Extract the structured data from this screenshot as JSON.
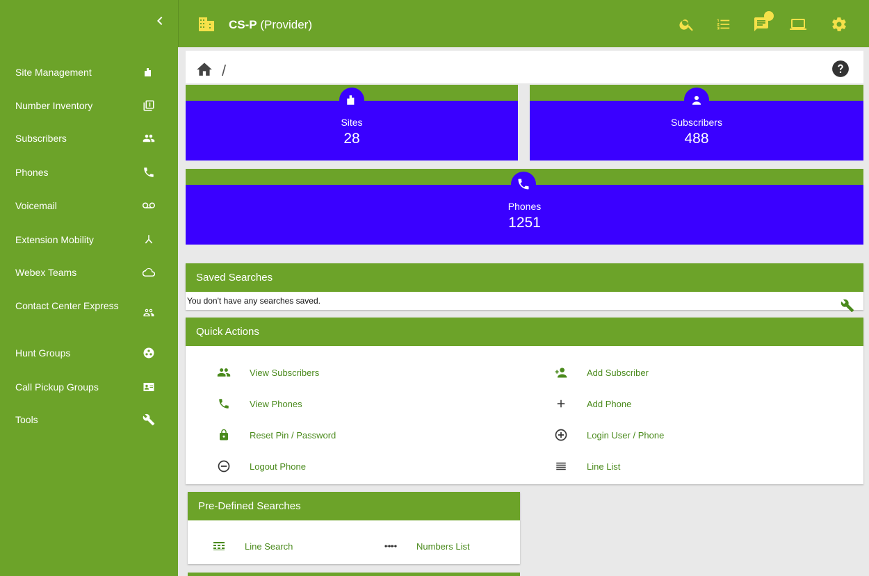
{
  "colors": {
    "brand_green": "#6ca329",
    "stat_blue": "#3a00ff",
    "link_green": "#4a8a1c",
    "badge_yellow": "#f5e14a"
  },
  "sidebar": {
    "collapse_icon": "chevron-left-icon",
    "items": [
      {
        "label": "Site Management",
        "icon": "buildings-icon"
      },
      {
        "label": "Number Inventory",
        "icon": "library-books-icon"
      },
      {
        "label": "Subscribers",
        "icon": "people-icon"
      },
      {
        "label": "Phones",
        "icon": "phone-icon"
      },
      {
        "label": "Voicemail",
        "icon": "voicemail-icon"
      },
      {
        "label": "Extension Mobility",
        "icon": "call-split-icon"
      },
      {
        "label": "Webex Teams",
        "icon": "cloud-icon"
      },
      {
        "label": "Contact Center Express",
        "icon": "people-outline-icon"
      },
      {
        "label": "Hunt Groups",
        "icon": "hunt-group-icon"
      },
      {
        "label": "Call Pickup Groups",
        "icon": "contact-card-icon"
      },
      {
        "label": "Tools",
        "icon": "wrench-icon"
      }
    ]
  },
  "topbar": {
    "title_bold": "CS-P",
    "title_rest": "(Provider)",
    "icons": [
      "search-icon",
      "list-icon",
      "chat-icon",
      "laptop-icon",
      "gear-icon"
    ]
  },
  "breadcrumb": {
    "separator": "/"
  },
  "stats": {
    "sites": {
      "label": "Sites",
      "value": "28"
    },
    "subscribers": {
      "label": "Subscribers",
      "value": "488"
    },
    "phones": {
      "label": "Phones",
      "value": "1251"
    }
  },
  "saved_searches": {
    "title": "Saved Searches",
    "empty_text": "You don't have any searches saved."
  },
  "quick_actions": {
    "title": "Quick Actions",
    "items": [
      {
        "label": "View Subscribers",
        "icon": "people-icon"
      },
      {
        "label": "Add Subscriber",
        "icon": "person-add-icon"
      },
      {
        "label": "View Phones",
        "icon": "phone-icon"
      },
      {
        "label": "Add Phone",
        "icon": "plus-icon"
      },
      {
        "label": "Reset Pin / Password",
        "icon": "lock-icon"
      },
      {
        "label": "Login User / Phone",
        "icon": "add-circle-icon"
      },
      {
        "label": "Logout Phone",
        "icon": "remove-circle-icon"
      },
      {
        "label": "Line List",
        "icon": "line-list-icon"
      }
    ]
  },
  "predefined_searches": {
    "title": "Pre-Defined Searches",
    "items": [
      {
        "label": "Line Search",
        "icon": "table-search-icon"
      },
      {
        "label": "Numbers List",
        "icon": "dots-icon"
      }
    ]
  }
}
